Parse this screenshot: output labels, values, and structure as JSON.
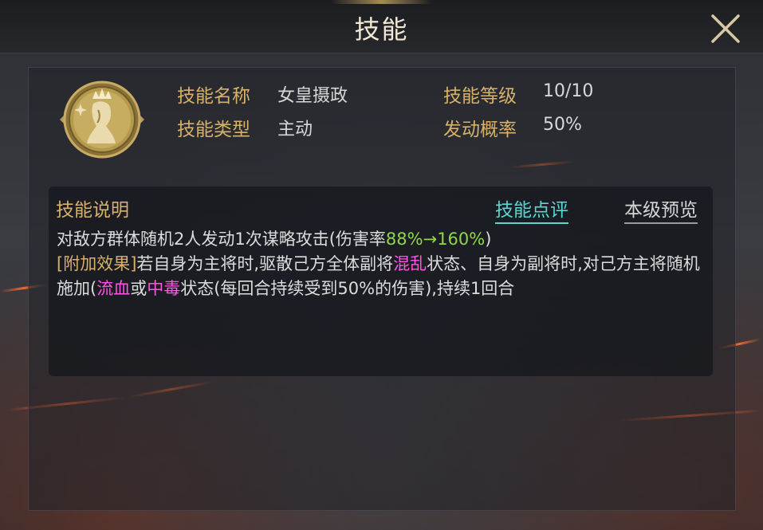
{
  "window": {
    "title": "技能"
  },
  "skill": {
    "name_label": "技能名称",
    "name": "女皇摄政",
    "level_label": "技能等级",
    "level": "10/10",
    "type_label": "技能类型",
    "type": "主动",
    "chance_label": "发动概率",
    "chance": "50%",
    "icon": "queen-crown-emblem-icon"
  },
  "description": {
    "title": "技能说明",
    "review_link": "技能点评",
    "preview_link": "本级预览",
    "line1_pre": "对敌方群体随机2人发动1次谋略攻击(伤害率",
    "line1_rate": "88%→160%",
    "line1_post": ")",
    "bonus_tag": "[附加效果]",
    "text_a": "若自身为主将时,驱散己方全体副将",
    "kw_chaos": "混乱",
    "text_b": "状态、自身为副将时,对己方主将随机施加(",
    "kw_bleed": "流血",
    "text_c": "或",
    "kw_poison": "中毒",
    "text_d": "状态(每回合持续受到50%的伤害),持续1回合"
  },
  "colors": {
    "label_gold": "#d7b16a",
    "rate_green": "#8fd64a",
    "keyword_pink": "#ff55e6",
    "link_cyan": "#5ad6d3"
  }
}
